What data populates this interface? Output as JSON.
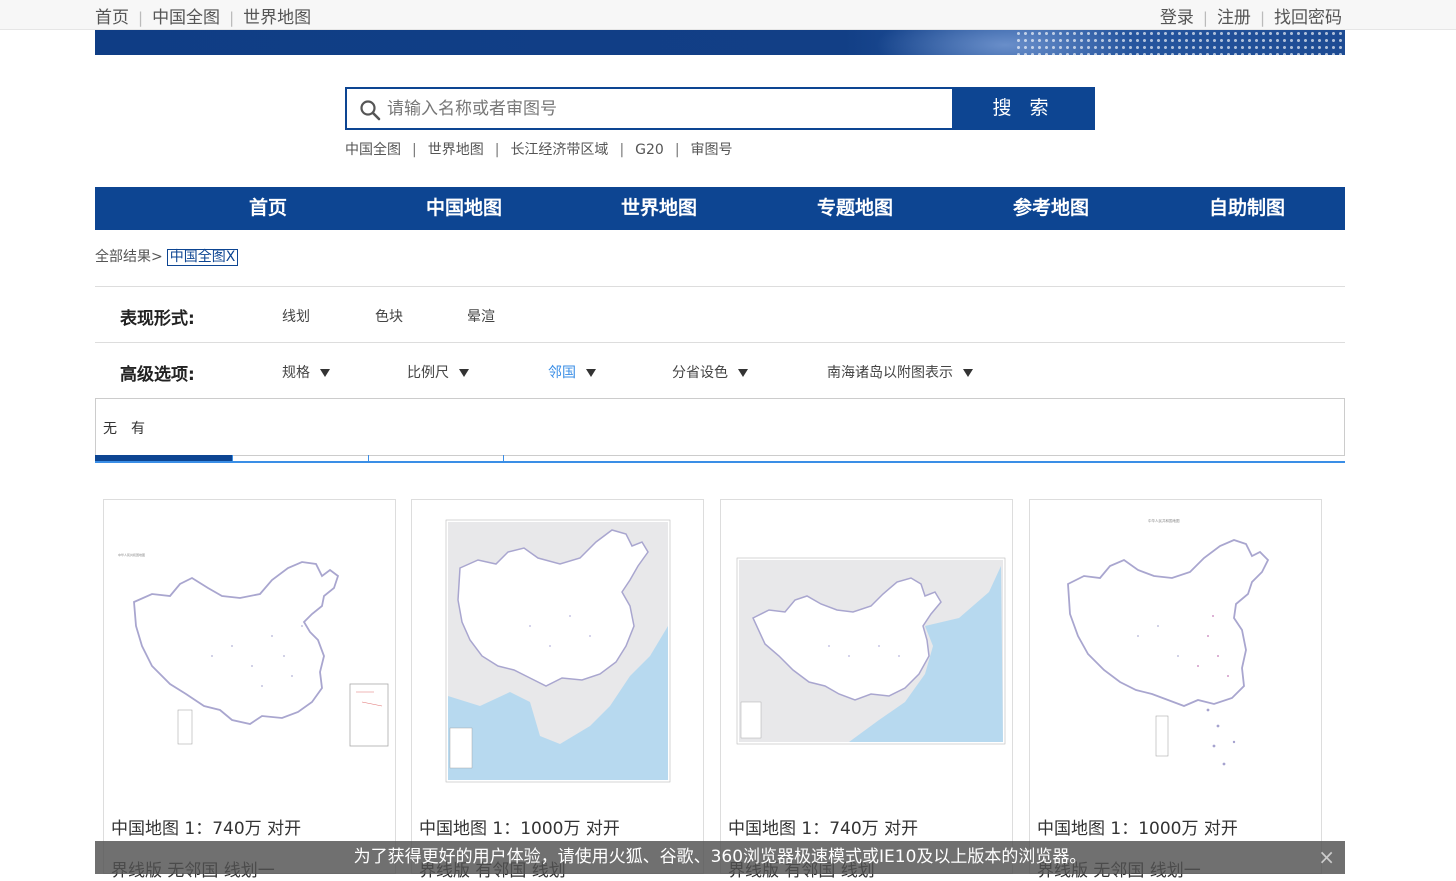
{
  "topbar": {
    "left_links": [
      "首页",
      "中国全图",
      "世界地图"
    ],
    "right_links": [
      "登录",
      "注册",
      "找回密码"
    ]
  },
  "search": {
    "placeholder": "请输入名称或者审图号",
    "button_label": "搜 索",
    "quick_links": [
      "中国全图",
      "世界地图",
      "长江经济带区域",
      "G20",
      "审图号"
    ]
  },
  "nav": {
    "items": [
      "首页",
      "中国地图",
      "世界地图",
      "专题地图",
      "参考地图",
      "自助制图"
    ]
  },
  "breadcrumb": {
    "root": "全部结果>",
    "tag": "中国全图X"
  },
  "filters": {
    "form_label": "表现形式:",
    "form_options": [
      "线划",
      "色块",
      "晕渲"
    ],
    "advanced_label": "高级选项:",
    "advanced_options": [
      "规格",
      "比例尺",
      "邻国",
      "分省设色",
      "南海诸岛以附图表示"
    ],
    "active_option": "邻国",
    "dropdown_values": [
      "无",
      "有"
    ]
  },
  "cards": [
    {
      "title": "中国地图 1：740万 对开",
      "sub": "界线版 无邻国 线划一"
    },
    {
      "title": "中国地图 1：1000万 对开",
      "sub": "界线版 有邻国 线划"
    },
    {
      "title": "中国地图 1：740万 对开",
      "sub": "界线版 有邻国 线划"
    },
    {
      "title": "中国地图 1：1000万 对开",
      "sub": "界线版 无邻国 线划一"
    }
  ],
  "notice": {
    "text": "为了获得更好的用户体验，请使用火狐、谷歌、360浏览器极速模式或IE10及以上版本的浏览器。",
    "close": "×"
  },
  "colors": {
    "brand": "#0d4592",
    "active": "#3a8ee6"
  }
}
